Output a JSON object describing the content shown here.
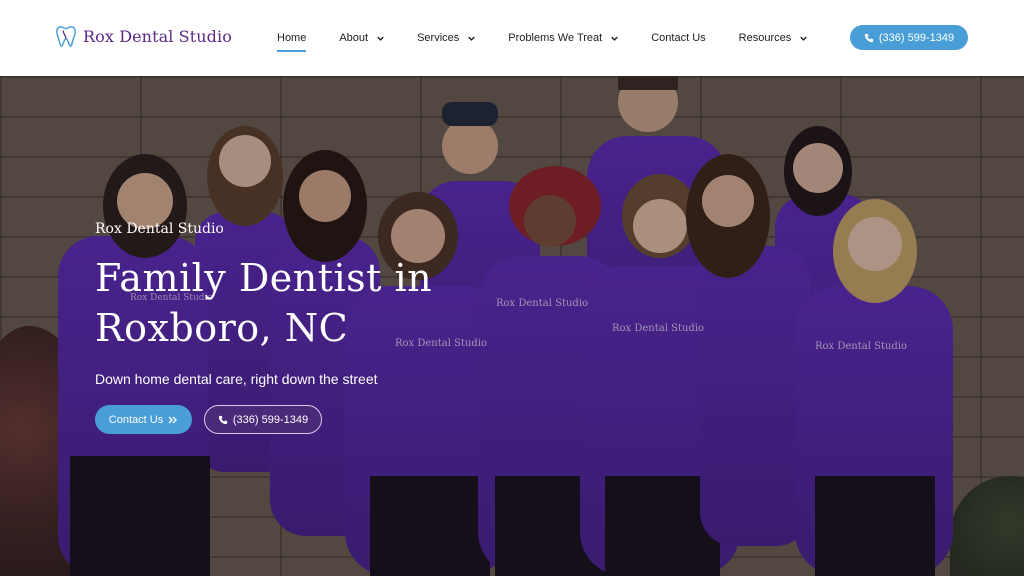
{
  "brand": {
    "name": "Rox Dental Studio",
    "color": "#5b2a86",
    "accent": "#4a9ed8"
  },
  "nav": {
    "items": [
      {
        "label": "Home",
        "active": true,
        "dropdown": false
      },
      {
        "label": "About",
        "active": false,
        "dropdown": true
      },
      {
        "label": "Services",
        "active": false,
        "dropdown": true
      },
      {
        "label": "Problems We Treat",
        "active": false,
        "dropdown": true
      },
      {
        "label": "Contact Us",
        "active": false,
        "dropdown": false
      },
      {
        "label": "Resources",
        "active": false,
        "dropdown": true
      }
    ],
    "phone": "(336) 599-1349"
  },
  "hero": {
    "eyebrow": "Rox Dental Studio",
    "headline": "Family Dentist in Roxboro, NC",
    "tagline": "Down home dental care, right down the street",
    "primary_cta": "Contact Us",
    "secondary_cta": "(336) 599-1349",
    "shirt_text": "Rox Dental Studio",
    "shirt_color": "#5a2ab0"
  }
}
